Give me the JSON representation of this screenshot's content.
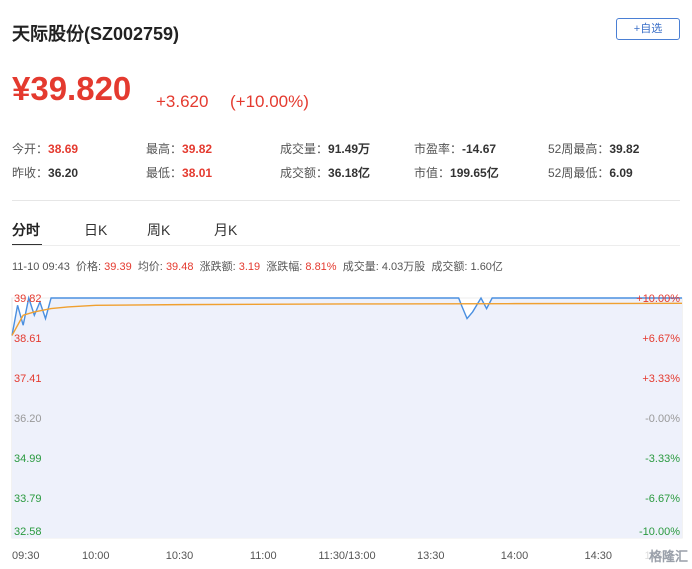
{
  "stock": {
    "name": "天际股份(SZ002759)",
    "watch_label": "+自选",
    "price": "¥39.820",
    "change": "+3.620",
    "change_pct": "(+10.00%)"
  },
  "quote": {
    "row1": [
      {
        "label": "今开：",
        "value": "38.69",
        "red": true
      },
      {
        "label": "最高：",
        "value": "39.82",
        "red": true
      },
      {
        "label": "成交量：",
        "value": "91.49万",
        "red": false
      },
      {
        "label": "市盈率：",
        "value": "-14.67",
        "red": false
      },
      {
        "label": "52周最高：",
        "value": "39.82",
        "red": false
      }
    ],
    "row2": [
      {
        "label": "昨收：",
        "value": "36.20",
        "red": false
      },
      {
        "label": "最低：",
        "value": "38.01",
        "red": true
      },
      {
        "label": "成交额：",
        "value": "36.18亿",
        "red": false
      },
      {
        "label": "市值：",
        "value": "199.65亿",
        "red": false
      },
      {
        "label": "52周最低：",
        "value": "6.09",
        "red": false
      }
    ]
  },
  "tabs": [
    "分时",
    "日K",
    "周K",
    "月K"
  ],
  "info": {
    "time": "11-10 09:43",
    "price_label": "价格:",
    "price": "39.39",
    "avg_label": "均价:",
    "avg": "39.48",
    "chg_label": "涨跌额:",
    "chg": "3.19",
    "pct_label": "涨跌幅:",
    "pct": "8.81%",
    "vol_label": "成交量:",
    "vol": "4.03万股",
    "amt_label": "成交额:",
    "amt": "1.60亿"
  },
  "colors": {
    "up": "#e43a2f",
    "down": "#2a9a3f",
    "neutral": "#999999",
    "price_line": "#4a8fe0",
    "avg_line": "#f0a030",
    "fill": "#eef1fb"
  },
  "chart_data": {
    "type": "line",
    "title": "",
    "xlabel": "",
    "ylabel": "",
    "ylim": [
      32.58,
      39.82
    ],
    "y_left_ticks": [
      "39.82",
      "38.61",
      "37.41",
      "36.20",
      "34.99",
      "33.79",
      "32.58"
    ],
    "y_right_ticks": [
      "+10.00%",
      "+6.67%",
      "+3.33%",
      "-0.00%",
      "-3.33%",
      "-6.67%",
      "-10.00%"
    ],
    "x_ticks": [
      "09:30",
      "10:00",
      "10:30",
      "11:00",
      "11:30/13:00",
      "13:30",
      "14:00",
      "14:30",
      "15:00"
    ],
    "watermark": "格隆汇",
    "corner_logo": "格隆汇",
    "series": [
      {
        "role": "price",
        "x": [
          0,
          2,
          4,
          6,
          8,
          10,
          12,
          14,
          16,
          18,
          20,
          22,
          24,
          26,
          28,
          30,
          60,
          120,
          160,
          161,
          163,
          165,
          168,
          170,
          172,
          174,
          176,
          178,
          180,
          210,
          240
        ],
        "y": [
          38.69,
          39.6,
          39.0,
          39.82,
          39.3,
          39.7,
          39.2,
          39.82,
          39.82,
          39.82,
          39.82,
          39.82,
          39.82,
          39.82,
          39.82,
          39.82,
          39.82,
          39.82,
          39.82,
          39.6,
          39.2,
          39.4,
          39.82,
          39.5,
          39.82,
          39.82,
          39.82,
          39.82,
          39.82,
          39.82,
          39.82
        ]
      },
      {
        "role": "average",
        "x": [
          0,
          4,
          8,
          14,
          20,
          30,
          60,
          120,
          180,
          240
        ],
        "y": [
          38.69,
          39.3,
          39.4,
          39.5,
          39.55,
          39.6,
          39.62,
          39.64,
          39.65,
          39.66
        ]
      }
    ]
  }
}
